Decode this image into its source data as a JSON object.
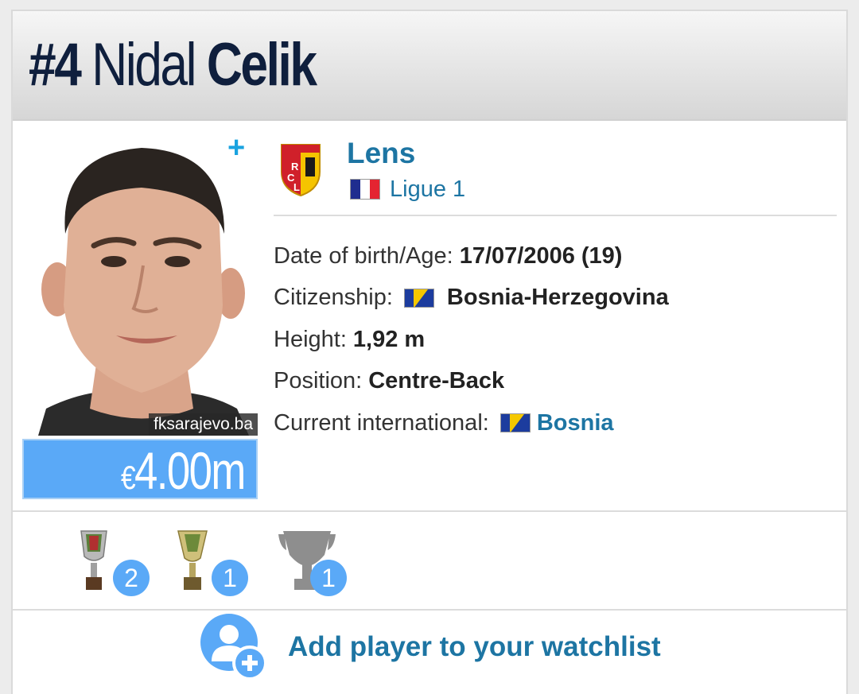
{
  "header": {
    "number": "#4",
    "first_name": "Nidal",
    "last_name": "Celik"
  },
  "photo": {
    "credit": "fksarajevo.ba",
    "add_icon": "plus-icon"
  },
  "market_value": {
    "currency": "€",
    "amount": "4.00m"
  },
  "club": {
    "name": "Lens",
    "league": "Ligue 1",
    "league_flag": "france-flag",
    "colors": {
      "red": "#d0202a",
      "yellow": "#f5c400"
    }
  },
  "facts": [
    {
      "label": "Date of birth/Age:",
      "value": "17/07/2006 (19)"
    },
    {
      "label": "Citizenship:",
      "value": "Bosnia-Herzegovina",
      "flag": "bosnia-flag"
    },
    {
      "label": "Height:",
      "value": "1,92 m"
    },
    {
      "label": "Position:",
      "value": "Centre-Back"
    },
    {
      "label": "Current international:",
      "value": "Bosnia",
      "flag": "bosnia-flag"
    }
  ],
  "trophies": [
    {
      "icon": "trophy-icon",
      "count": "2"
    },
    {
      "icon": "trophy-icon",
      "count": "1"
    },
    {
      "icon": "trophy-silver-icon",
      "count": "1"
    }
  ],
  "watchlist": {
    "label": "Add player to your watchlist",
    "icon": "add-user-icon"
  },
  "colors": {
    "link": "#1d75a3",
    "accent": "#5aa9f7",
    "title": "#0f1f3d"
  }
}
